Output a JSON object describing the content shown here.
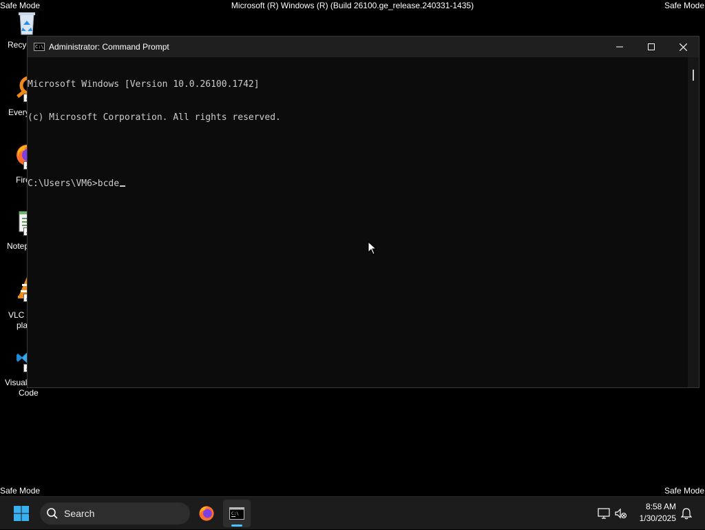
{
  "watermark": {
    "top_left": "Safe Mode",
    "top_right": "Safe Mode",
    "bottom_left": "Safe Mode",
    "bottom_right": "Safe Mode",
    "build": "Microsoft (R) Windows (R) (Build 26100.ge_release.240331-1435)"
  },
  "desktop_icons": [
    {
      "label": "Recyc",
      "icon": "recycle-bin-icon"
    },
    {
      "label": "Every",
      "icon": "everything-icon"
    },
    {
      "label": "Fire",
      "icon": "firefox-icon"
    },
    {
      "label": "Notep",
      "icon": "notepad-icon"
    },
    {
      "label": "VLC m",
      "label2": "pla",
      "icon": "vlc-icon"
    },
    {
      "label": "Visual",
      "label2": "Code",
      "icon": "vscode-icon"
    }
  ],
  "window": {
    "title": "Administrator: Command Prompt",
    "minimize_label": "minimize",
    "maximize_label": "maximize",
    "close_label": "close"
  },
  "console": {
    "lines": [
      "Microsoft Windows [Version 10.0.26100.1742]",
      "(c) Microsoft Corporation. All rights reserved.",
      "",
      "C:\\Users\\VM6>bcde"
    ]
  },
  "taskbar": {
    "search_placeholder": "Search",
    "apps": [
      {
        "name": "Firefox",
        "icon": "firefox-icon",
        "active": false
      },
      {
        "name": "Command Prompt",
        "icon": "command-prompt-icon",
        "active": true
      }
    ],
    "clock": {
      "time": "8:58 AM",
      "date": "1/30/2025"
    }
  },
  "colors": {
    "accent": "#4cc2ff",
    "console_text": "#cccccc",
    "console_bg": "#0c0c0c",
    "titlebar_bg": "#1f1f1f",
    "taskbar_bg": "#1c1c1c"
  }
}
